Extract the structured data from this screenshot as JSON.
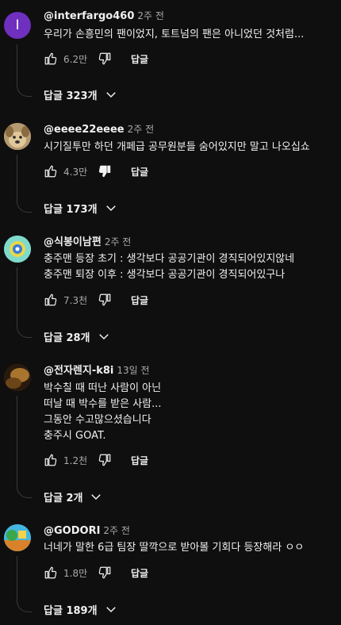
{
  "comments": [
    {
      "author": "@interfargo460",
      "time": "2주 전",
      "avatar_letter": "I",
      "avatar_color": "#6f2fbf",
      "lines": [
        "우리가 손흥민의 팬이었지, 토트넘의 팬은 아니었던 것처럼..."
      ],
      "likes": "6.2만",
      "reply_label": "답글",
      "replies_label": "답글 323개"
    },
    {
      "author": "@eeee22eeee",
      "time": "2주 전",
      "avatar_color": "#c9b28a",
      "lines": [
        "시기질투만 하던 개페급 공무원분들 숨어있지만 말고 나오십쇼"
      ],
      "likes": "4.3만",
      "reply_label": "답글",
      "replies_label": "답글 173개"
    },
    {
      "author": "@식봉이남편",
      "time": "2주 전",
      "avatar_color": "#6fd6c5",
      "lines": [
        "충주맨 등장 초기 : 생각보다 공공기관이 경직되어있지않네",
        "충주맨 퇴장 이후 : 생각보다 공공기관이 경직되어있구나"
      ],
      "likes": "7.3천",
      "reply_label": "답글",
      "replies_label": "답글 28개"
    },
    {
      "author": "@전자렌지-k8i",
      "time": "13일 전",
      "avatar_color": "#5a3a1a",
      "lines": [
        "박수칠 때 떠난 사람이 아닌",
        "떠날 때 박수를 받은 사람...",
        "그동안 수고많으셨습니다",
        "충주시 GOAT."
      ],
      "likes": "1.2천",
      "reply_label": "답글",
      "replies_label": "답글 2개"
    },
    {
      "author": "@GODORI",
      "time": "2주 전",
      "avatar_color": "#39a7d6",
      "lines": [
        "너네가 말한 6급 팀장 딸깍으로 받아볼 기회다 등장해라 ㅇㅇ"
      ],
      "likes": "1.8만",
      "reply_label": "답글",
      "replies_label": "답글 189개"
    }
  ]
}
